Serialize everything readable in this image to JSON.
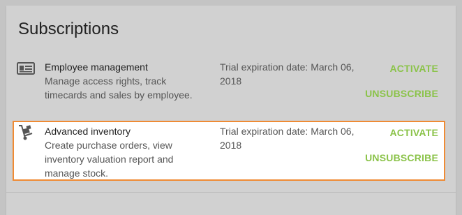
{
  "subscriptions": {
    "title": "Subscriptions",
    "items": [
      {
        "icon": "id-card-icon",
        "name": "Employee management",
        "description": "Manage access rights, track timecards and sales by employee.",
        "trial_text": "Trial expiration date: March 06, 2018",
        "activate_label": "ACTIVATE",
        "unsubscribe_label": "UNSUBSCRIBE"
      },
      {
        "icon": "hand-truck-icon",
        "name": "Advanced inventory",
        "description": "Create purchase orders, view inventory valuation report and manage stock.",
        "trial_text": "Trial expiration date: March 06, 2018",
        "activate_label": "ACTIVATE",
        "unsubscribe_label": "UNSUBSCRIBE"
      }
    ]
  },
  "colors": {
    "accent_green": "#8bc34a",
    "highlight_border": "#ef8b34"
  }
}
